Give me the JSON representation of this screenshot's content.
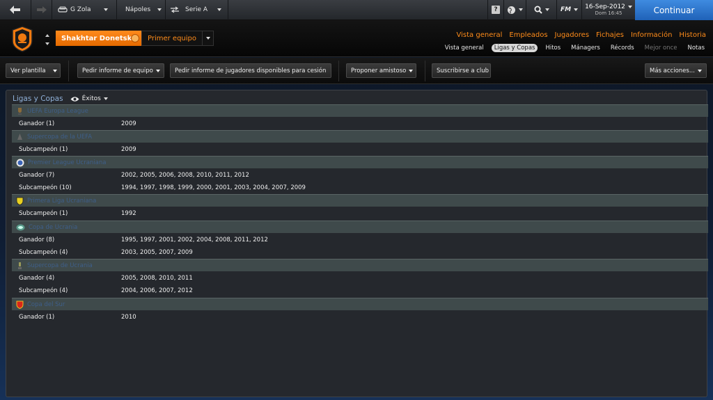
{
  "topbar": {
    "manager": "G Zola",
    "club_link": "Nápoles",
    "league_link": "Serie A",
    "fm_label": "FM",
    "date": "16-Sep-2012",
    "time": "Dom 16:45",
    "continue_label": "Continuar"
  },
  "club": {
    "name": "Shakhtar Donetsk",
    "team": "Primer equipo"
  },
  "main_nav": [
    "Vista general",
    "Empleados",
    "Jugadores",
    "Fichajes",
    "Información",
    "Historia"
  ],
  "sub_nav": [
    {
      "label": "Vista general",
      "state": "normal"
    },
    {
      "label": "Ligas y Copas",
      "state": "active"
    },
    {
      "label": "Hitos",
      "state": "normal"
    },
    {
      "label": "Mánagers",
      "state": "normal"
    },
    {
      "label": "Récords",
      "state": "normal"
    },
    {
      "label": "Mejor once",
      "state": "disabled"
    },
    {
      "label": "Notas",
      "state": "normal"
    }
  ],
  "actions": {
    "ver_plantilla": "Ver plantilla",
    "pedir_informe_equipo": "Pedir informe de equipo",
    "pedir_informe_jugadores": "Pedir informe de jugadores disponibles para cesión",
    "proponer_amistoso": "Proponer amistoso",
    "suscribirse": "Suscribirse a club",
    "mas_acciones": "Más acciones..."
  },
  "panel": {
    "title": "Ligas y Copas",
    "filter": "Éxitos"
  },
  "competitions": [
    {
      "name": "UEFA Europa League",
      "icon_color": "#8a6a3a",
      "rows": [
        {
          "label": "Ganador  (1)",
          "years": "2009"
        }
      ]
    },
    {
      "name": "Supercopa de la UEFA",
      "icon_color": "#666666",
      "rows": [
        {
          "label": "Subcampeón  (1)",
          "years": "2009"
        }
      ]
    },
    {
      "name": "Premier League Ucraniana",
      "icon_color": "#3a64b8",
      "rows": [
        {
          "label": "Ganador  (7)",
          "years": "2002, 2005, 2006, 2008, 2010, 2011, 2012"
        },
        {
          "label": "Subcampeón  (10)",
          "years": "1994, 1997, 1998, 1999, 2000, 2001, 2003, 2004, 2007, 2009"
        }
      ]
    },
    {
      "name": "Primera Liga Ucraniana",
      "icon_color": "#e8d020",
      "rows": [
        {
          "label": "Subcampeón  (1)",
          "years": "1992"
        }
      ]
    },
    {
      "name": "Copa de Ucrania",
      "icon_color": "#5a9a8a",
      "rows": [
        {
          "label": "Ganador  (8)",
          "years": "1995, 1997, 2001, 2002, 2004, 2008, 2011, 2012"
        },
        {
          "label": "Subcampeón  (4)",
          "years": "2003, 2005, 2007, 2009"
        }
      ]
    },
    {
      "name": "Supercopa de Ucrania",
      "icon_color": "#9a9a5a",
      "rows": [
        {
          "label": "Ganador  (4)",
          "years": "2005, 2008, 2010, 2011"
        },
        {
          "label": "Subcampeón  (4)",
          "years": "2004, 2006, 2007, 2012"
        }
      ]
    },
    {
      "name": "Copa del Sur",
      "icon_color": "#d8261a",
      "rows": [
        {
          "label": "Ganador  (1)",
          "years": "2010"
        }
      ]
    }
  ]
}
